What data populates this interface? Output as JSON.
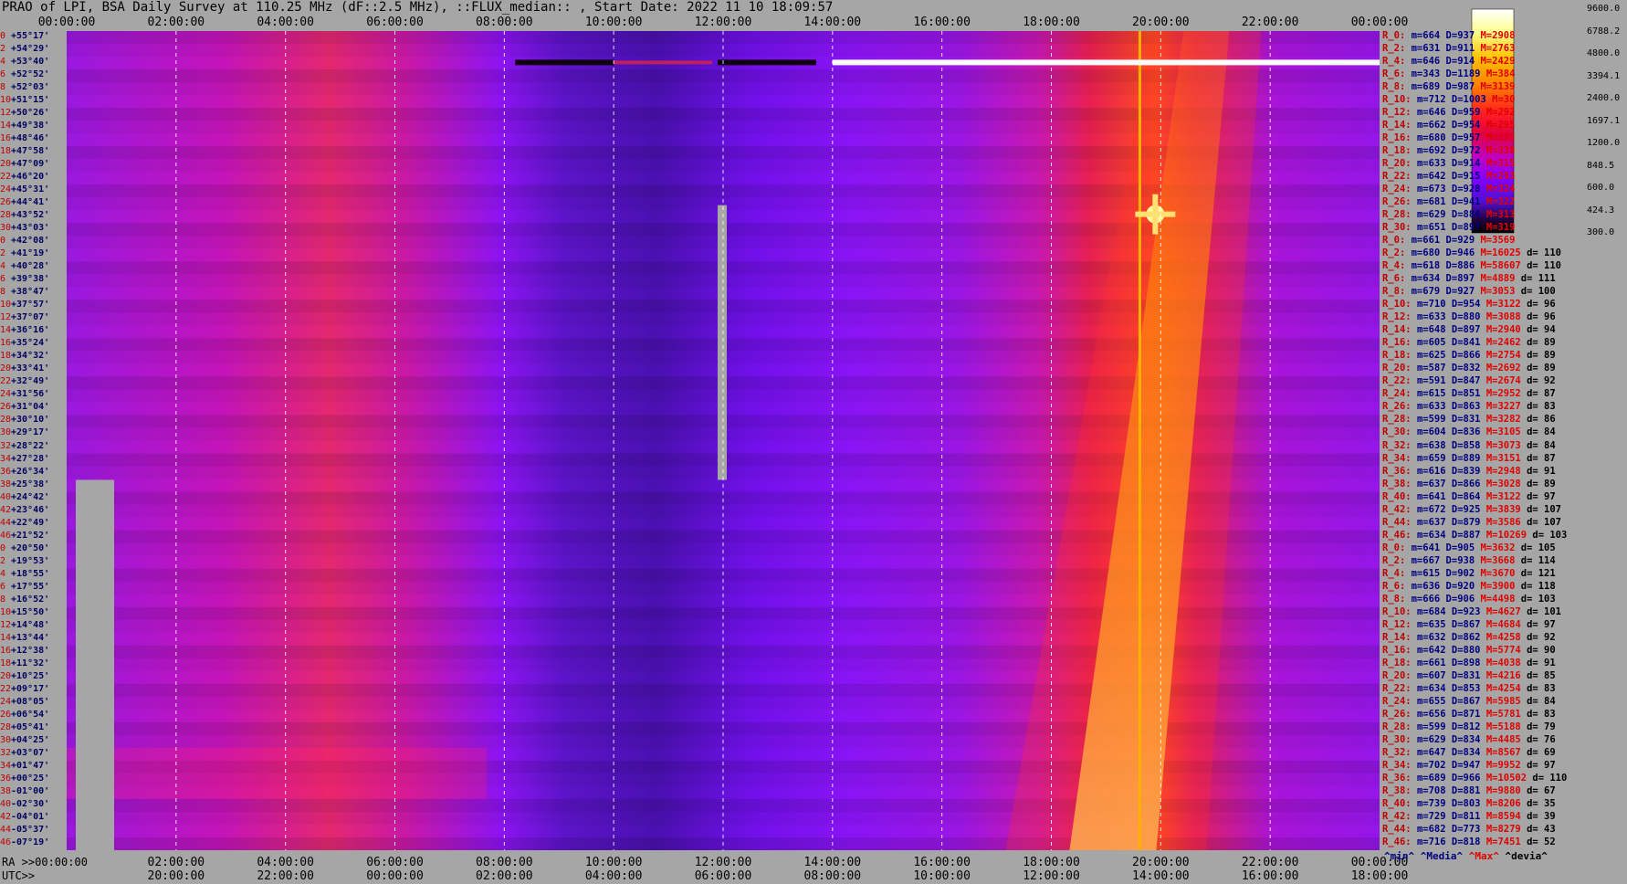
{
  "title": "PRAO of LPI, BSA Daily Survey at 110.25 MHz (dF::2.5 MHz), ::FLUX_median:: , Start Date: 2022 11 10 18:09:57",
  "top_ticks": [
    "00:00:00",
    "02:00:00",
    "04:00:00",
    "06:00:00",
    "08:00:00",
    "10:00:00",
    "12:00:00",
    "14:00:00",
    "16:00:00",
    "18:00:00",
    "20:00:00",
    "22:00:00",
    "00:00:00"
  ],
  "bottom_ticks_ra": [
    "02:00:00",
    "04:00:00",
    "06:00:00",
    "08:00:00",
    "10:00:00",
    "12:00:00",
    "14:00:00",
    "16:00:00",
    "18:00:00",
    "20:00:00",
    "22:00:00",
    "00:00:00"
  ],
  "bottom_ticks_utc": [
    "20:00:00",
    "22:00:00",
    "00:00:00",
    "02:00:00",
    "04:00:00",
    "06:00:00",
    "08:00:00",
    "10:00:00",
    "12:00:00",
    "14:00:00",
    "16:00:00",
    "18:00:00"
  ],
  "ra_label": "RA >>00:00:00",
  "utc_label": "UTC>>",
  "row_labels": [
    {
      "idx": "0",
      "dec": "+55°17'"
    },
    {
      "idx": "2",
      "dec": "+54°29'"
    },
    {
      "idx": "4",
      "dec": "+53°40'"
    },
    {
      "idx": "6",
      "dec": "+52°52'"
    },
    {
      "idx": "8",
      "dec": "+52°03'"
    },
    {
      "idx": "10",
      "dec": "+51°15'"
    },
    {
      "idx": "12",
      "dec": "+50°26'"
    },
    {
      "idx": "14",
      "dec": "+49°38'"
    },
    {
      "idx": "16",
      "dec": "+48°46'"
    },
    {
      "idx": "18",
      "dec": "+47°58'"
    },
    {
      "idx": "20",
      "dec": "+47°09'"
    },
    {
      "idx": "22",
      "dec": "+46°20'"
    },
    {
      "idx": "24",
      "dec": "+45°31'"
    },
    {
      "idx": "26",
      "dec": "+44°41'"
    },
    {
      "idx": "28",
      "dec": "+43°52'"
    },
    {
      "idx": "30",
      "dec": "+43°03'"
    },
    {
      "idx": "0",
      "dec": "+42°08'"
    },
    {
      "idx": "2",
      "dec": "+41°19'"
    },
    {
      "idx": "4",
      "dec": "+40°28'"
    },
    {
      "idx": "6",
      "dec": "+39°38'"
    },
    {
      "idx": "8",
      "dec": "+38°47'"
    },
    {
      "idx": "10",
      "dec": "+37°57'"
    },
    {
      "idx": "12",
      "dec": "+37°07'"
    },
    {
      "idx": "14",
      "dec": "+36°16'"
    },
    {
      "idx": "16",
      "dec": "+35°24'"
    },
    {
      "idx": "18",
      "dec": "+34°32'"
    },
    {
      "idx": "20",
      "dec": "+33°41'"
    },
    {
      "idx": "22",
      "dec": "+32°49'"
    },
    {
      "idx": "24",
      "dec": "+31°56'"
    },
    {
      "idx": "26",
      "dec": "+31°04'"
    },
    {
      "idx": "28",
      "dec": "+30°10'"
    },
    {
      "idx": "30",
      "dec": "+29°17'"
    },
    {
      "idx": "32",
      "dec": "+28°22'"
    },
    {
      "idx": "34",
      "dec": "+27°28'"
    },
    {
      "idx": "36",
      "dec": "+26°34'"
    },
    {
      "idx": "38",
      "dec": "+25°38'"
    },
    {
      "idx": "40",
      "dec": "+24°42'"
    },
    {
      "idx": "42",
      "dec": "+23°46'"
    },
    {
      "idx": "44",
      "dec": "+22°49'"
    },
    {
      "idx": "46",
      "dec": "+21°52'"
    },
    {
      "idx": "0",
      "dec": "+20°50'"
    },
    {
      "idx": "2",
      "dec": "+19°53'"
    },
    {
      "idx": "4",
      "dec": "+18°55'"
    },
    {
      "idx": "6",
      "dec": "+17°55'"
    },
    {
      "idx": "8",
      "dec": "+16°52'"
    },
    {
      "idx": "10",
      "dec": "+15°50'"
    },
    {
      "idx": "12",
      "dec": "+14°48'"
    },
    {
      "idx": "14",
      "dec": "+13°44'"
    },
    {
      "idx": "16",
      "dec": "+12°38'"
    },
    {
      "idx": "18",
      "dec": "+11°32'"
    },
    {
      "idx": "20",
      "dec": "+10°25'"
    },
    {
      "idx": "22",
      "dec": "+09°17'"
    },
    {
      "idx": "24",
      "dec": "+08°05'"
    },
    {
      "idx": "26",
      "dec": "+06°54'"
    },
    {
      "idx": "28",
      "dec": "+05°41'"
    },
    {
      "idx": "30",
      "dec": "+04°25'"
    },
    {
      "idx": "32",
      "dec": "+03°07'"
    },
    {
      "idx": "34",
      "dec": "+01°47'"
    },
    {
      "idx": "36",
      "dec": "+00°25'"
    },
    {
      "idx": "38",
      "dec": "-01°00'"
    },
    {
      "idx": "40",
      "dec": "-02°30'"
    },
    {
      "idx": "42",
      "dec": "-04°01'"
    },
    {
      "idx": "44",
      "dec": "-05°37'"
    },
    {
      "idx": "46",
      "dec": "-07°19'"
    }
  ],
  "stats": [
    {
      "r": "R_0:",
      "m": "m=664",
      "d": "D=937",
      "h": "M=2908",
      "dv": ""
    },
    {
      "r": "R_2:",
      "m": "m=631",
      "d": "D=911",
      "h": "M=2763",
      "dv": ""
    },
    {
      "r": "R_4:",
      "m": "m=646",
      "d": "D=914",
      "h": "M=2429",
      "dv": ""
    },
    {
      "r": "R_6:",
      "m": "m=343",
      "d": "D=1189",
      "h": "M=384",
      "dv": ""
    },
    {
      "r": "R_8:",
      "m": "m=689",
      "d": "D=987",
      "h": "M=3139",
      "dv": ""
    },
    {
      "r": "R_10:",
      "m": "m=712",
      "d": "D=1003",
      "h": "M=30",
      "dv": ""
    },
    {
      "r": "R_12:",
      "m": "m=646",
      "d": "D=959",
      "h": "M=292",
      "dv": ""
    },
    {
      "r": "R_14:",
      "m": "m=662",
      "d": "D=954",
      "h": "M=295",
      "dv": ""
    },
    {
      "r": "R_16:",
      "m": "m=680",
      "d": "D=957",
      "h": "M=333",
      "dv": ""
    },
    {
      "r": "R_18:",
      "m": "m=692",
      "d": "D=972",
      "h": "M=338",
      "dv": ""
    },
    {
      "r": "R_20:",
      "m": "m=633",
      "d": "D=914",
      "h": "M=315",
      "dv": ""
    },
    {
      "r": "R_22:",
      "m": "m=642",
      "d": "D=915",
      "h": "M=293",
      "dv": ""
    },
    {
      "r": "R_24:",
      "m": "m=673",
      "d": "D=928",
      "h": "M=324",
      "dv": ""
    },
    {
      "r": "R_26:",
      "m": "m=681",
      "d": "D=941",
      "h": "M=322",
      "dv": ""
    },
    {
      "r": "R_28:",
      "m": "m=629",
      "d": "D=884",
      "h": "M=313",
      "dv": ""
    },
    {
      "r": "R_30:",
      "m": "m=651",
      "d": "D=897",
      "h": "M=319",
      "dv": ""
    },
    {
      "r": "R_0:",
      "m": "m=661",
      "d": "D=929",
      "h": "M=3569",
      "dv": ""
    },
    {
      "r": "R_2:",
      "m": "m=680",
      "d": "D=946",
      "h": "M=16025",
      "dv": "d= 110"
    },
    {
      "r": "R_4:",
      "m": "m=618",
      "d": "D=886",
      "h": "M=58607",
      "dv": "d= 110"
    },
    {
      "r": "R_6:",
      "m": "m=634",
      "d": "D=897",
      "h": "M=4889",
      "dv": "d= 111"
    },
    {
      "r": "R_8:",
      "m": "m=679",
      "d": "D=927",
      "h": "M=3053",
      "dv": "d= 100"
    },
    {
      "r": "R_10:",
      "m": "m=710",
      "d": "D=954",
      "h": "M=3122",
      "dv": "d= 96"
    },
    {
      "r": "R_12:",
      "m": "m=633",
      "d": "D=880",
      "h": "M=3088",
      "dv": "d= 96"
    },
    {
      "r": "R_14:",
      "m": "m=648",
      "d": "D=897",
      "h": "M=2940",
      "dv": "d= 94"
    },
    {
      "r": "R_16:",
      "m": "m=605",
      "d": "D=841",
      "h": "M=2462",
      "dv": "d= 89"
    },
    {
      "r": "R_18:",
      "m": "m=625",
      "d": "D=866",
      "h": "M=2754",
      "dv": "d= 89"
    },
    {
      "r": "R_20:",
      "m": "m=587",
      "d": "D=832",
      "h": "M=2692",
      "dv": "d= 89"
    },
    {
      "r": "R_22:",
      "m": "m=591",
      "d": "D=847",
      "h": "M=2674",
      "dv": "d= 92"
    },
    {
      "r": "R_24:",
      "m": "m=615",
      "d": "D=851",
      "h": "M=2952",
      "dv": "d= 87"
    },
    {
      "r": "R_26:",
      "m": "m=633",
      "d": "D=863",
      "h": "M=3227",
      "dv": "d= 83"
    },
    {
      "r": "R_28:",
      "m": "m=599",
      "d": "D=831",
      "h": "M=3282",
      "dv": "d= 86"
    },
    {
      "r": "R_30:",
      "m": "m=604",
      "d": "D=836",
      "h": "M=3105",
      "dv": "d= 84"
    },
    {
      "r": "R_32:",
      "m": "m=638",
      "d": "D=858",
      "h": "M=3073",
      "dv": "d= 84"
    },
    {
      "r": "R_34:",
      "m": "m=659",
      "d": "D=889",
      "h": "M=3151",
      "dv": "d= 87"
    },
    {
      "r": "R_36:",
      "m": "m=616",
      "d": "D=839",
      "h": "M=2948",
      "dv": "d= 91"
    },
    {
      "r": "R_38:",
      "m": "m=637",
      "d": "D=866",
      "h": "M=3028",
      "dv": "d= 89"
    },
    {
      "r": "R_40:",
      "m": "m=641",
      "d": "D=864",
      "h": "M=3122",
      "dv": "d= 97"
    },
    {
      "r": "R_42:",
      "m": "m=672",
      "d": "D=925",
      "h": "M=3839",
      "dv": "d= 107"
    },
    {
      "r": "R_44:",
      "m": "m=637",
      "d": "D=879",
      "h": "M=3586",
      "dv": "d= 107"
    },
    {
      "r": "R_46:",
      "m": "m=634",
      "d": "D=887",
      "h": "M=10269",
      "dv": "d= 103"
    },
    {
      "r": "R_0:",
      "m": "m=641",
      "d": "D=905",
      "h": "M=3632",
      "dv": "d= 105"
    },
    {
      "r": "R_2:",
      "m": "m=667",
      "d": "D=938",
      "h": "M=3668",
      "dv": "d= 114"
    },
    {
      "r": "R_4:",
      "m": "m=615",
      "d": "D=902",
      "h": "M=3670",
      "dv": "d= 121"
    },
    {
      "r": "R_6:",
      "m": "m=636",
      "d": "D=920",
      "h": "M=3900",
      "dv": "d= 118"
    },
    {
      "r": "R_8:",
      "m": "m=666",
      "d": "D=906",
      "h": "M=4498",
      "dv": "d= 103"
    },
    {
      "r": "R_10:",
      "m": "m=684",
      "d": "D=923",
      "h": "M=4627",
      "dv": "d= 101"
    },
    {
      "r": "R_12:",
      "m": "m=635",
      "d": "D=867",
      "h": "M=4684",
      "dv": "d= 97"
    },
    {
      "r": "R_14:",
      "m": "m=632",
      "d": "D=862",
      "h": "M=4258",
      "dv": "d= 92"
    },
    {
      "r": "R_16:",
      "m": "m=642",
      "d": "D=880",
      "h": "M=5774",
      "dv": "d= 90"
    },
    {
      "r": "R_18:",
      "m": "m=661",
      "d": "D=898",
      "h": "M=4038",
      "dv": "d= 91"
    },
    {
      "r": "R_20:",
      "m": "m=607",
      "d": "D=831",
      "h": "M=4216",
      "dv": "d= 85"
    },
    {
      "r": "R_22:",
      "m": "m=634",
      "d": "D=853",
      "h": "M=4254",
      "dv": "d= 83"
    },
    {
      "r": "R_24:",
      "m": "m=655",
      "d": "D=867",
      "h": "M=5985",
      "dv": "d= 84"
    },
    {
      "r": "R_26:",
      "m": "m=656",
      "d": "D=871",
      "h": "M=5781",
      "dv": "d= 83"
    },
    {
      "r": "R_28:",
      "m": "m=599",
      "d": "D=812",
      "h": "M=5188",
      "dv": "d= 79"
    },
    {
      "r": "R_30:",
      "m": "m=629",
      "d": "D=834",
      "h": "M=4485",
      "dv": "d= 76"
    },
    {
      "r": "R_32:",
      "m": "m=647",
      "d": "D=834",
      "h": "M=8567",
      "dv": "d= 69"
    },
    {
      "r": "R_34:",
      "m": "m=702",
      "d": "D=947",
      "h": "M=9952",
      "dv": "d= 97"
    },
    {
      "r": "R_36:",
      "m": "m=689",
      "d": "D=966",
      "h": "M=10502",
      "dv": "d= 110"
    },
    {
      "r": "R_38:",
      "m": "m=708",
      "d": "D=881",
      "h": "M=9880",
      "dv": "d= 67"
    },
    {
      "r": "R_40:",
      "m": "m=739",
      "d": "D=803",
      "h": "M=8206",
      "dv": "d= 35"
    },
    {
      "r": "R_42:",
      "m": "m=729",
      "d": "D=811",
      "h": "M=8594",
      "dv": "d= 39"
    },
    {
      "r": "R_44:",
      "m": "m=682",
      "d": "D=773",
      "h": "M=8279",
      "dv": "d= 43"
    },
    {
      "r": "R_46:",
      "m": "m=716",
      "d": "D=818",
      "h": "M=7451",
      "dv": "d= 52"
    }
  ],
  "stats_legend": {
    "min": "^min^",
    "median": "^Media^",
    "max": "^Max^",
    "devia": "^devia^"
  },
  "chart_data": {
    "type": "heatmap",
    "title": "PRAO of LPI, BSA Daily Survey at 110.25 MHz (dF::2.5 MHz), ::FLUX_median:: , Start Date: 2022 11 10 18:09:57",
    "x_axis": "RA (hours, 0–24)",
    "y_axis": "Declination",
    "colorbar": {
      "ticks": [
        9600.0,
        6788.2,
        4800.0,
        3394.1,
        2400.0,
        1697.1,
        1200.0,
        848.5,
        600.0,
        424.3,
        300.0
      ],
      "colors": [
        "#ffffff",
        "#ffff80",
        "#ffc000",
        "#ff8000",
        "#ff2000",
        "#e00040",
        "#c000c0",
        "#8000ff",
        "#5010d0",
        "#200040",
        "#000000"
      ]
    },
    "features": [
      {
        "name": "milky-way-ridge",
        "ra_hours": [
          19.0,
          20.5
        ],
        "dec_range": [
          -7.3,
          55.3
        ]
      },
      {
        "name": "bright-source",
        "ra_hours": 19.9,
        "dec": 41.3
      },
      {
        "name": "blank-row",
        "ra_hours": [
          14.0,
          24.0
        ],
        "dec": 52.9
      },
      {
        "name": "gap-bar",
        "ra_hours": 11.9,
        "dec_range": [
          21.0,
          42.0
        ]
      },
      {
        "name": "gap-bar",
        "ra_hours": 0.5,
        "dec_range": [
          -7.3,
          21.0
        ]
      }
    ]
  }
}
